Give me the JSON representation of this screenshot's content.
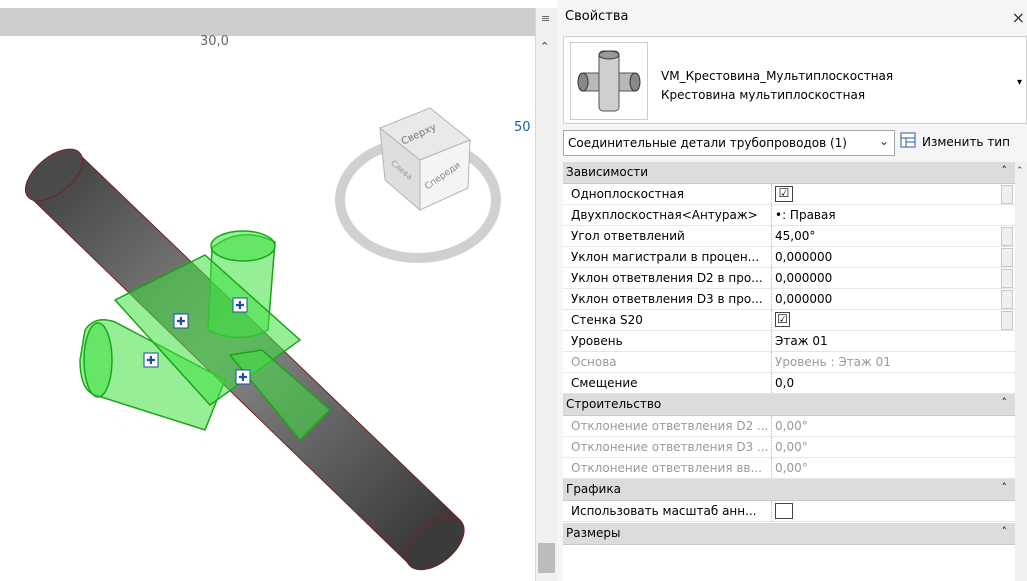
{
  "viewport": {
    "scale_label": "30,0",
    "zoom_label": "50",
    "viewcube": {
      "top": "Сверху",
      "front": "Спереди",
      "left": "Слева"
    }
  },
  "properties": {
    "title": "Свойства",
    "close": "×",
    "type_name": "VM_Крестовина_Мультиплоскостная",
    "type_subname": "Крестовина мультиплоскостная",
    "type_dropdown_glyph": "▾",
    "selector": "Соединительные детали трубопроводов (1)",
    "selector_arrow": "⌄",
    "edit_type": "Изменить тип",
    "groups": {
      "constraints": {
        "label": "Зависимости",
        "toggle": "˄"
      },
      "construction": {
        "label": "Строительство",
        "toggle": "˄"
      },
      "graphics": {
        "label": "Графика",
        "toggle": "˄"
      },
      "dimensions": {
        "label": "Размеры",
        "toggle": "˄"
      }
    },
    "rows": {
      "single_plane": {
        "name": "Одноплоскостная",
        "checked": "☑"
      },
      "two_plane": {
        "name": "Двухплоскостная<Антураж>",
        "value": "•: Правая"
      },
      "branch_angle": {
        "name": "Угол ответвлений",
        "value": "45,00°"
      },
      "main_slope": {
        "name": "Уклон магистрали в процен...",
        "value": "0,000000"
      },
      "d2_slope": {
        "name": "Уклон ответвления D2 в про...",
        "value": "0,000000"
      },
      "d3_slope": {
        "name": "Уклон ответвления D3 в про...",
        "value": "0,000000"
      },
      "wall": {
        "name": "Стенка S20",
        "checked": "☑"
      },
      "level": {
        "name": "Уровень",
        "value": "Этаж 01"
      },
      "base": {
        "name": "Основа",
        "value": "Уровень : Этаж 01"
      },
      "offset": {
        "name": "Смещение",
        "value": "0,0"
      },
      "dev_d2": {
        "name": "Отклонение ответвления D2 ...",
        "value": "0,00°"
      },
      "dev_d3": {
        "name": "Отклонение ответвления D3 ...",
        "value": "0,00°"
      },
      "dev_up": {
        "name": "Отклонение ответвления вв...",
        "value": "0,00°"
      },
      "annot_scale": {
        "name": "Использовать масштаб анн...",
        "checked": ""
      }
    }
  },
  "colors": {
    "selection": "#3fe03f",
    "pipe": "#5a5a5a",
    "link": "#1a5fa8"
  },
  "icons": [
    "menu-icon",
    "scroll-up-icon",
    "close-icon",
    "edit-type-icon",
    "move-handle-icon",
    "chevron-down-icon"
  ]
}
